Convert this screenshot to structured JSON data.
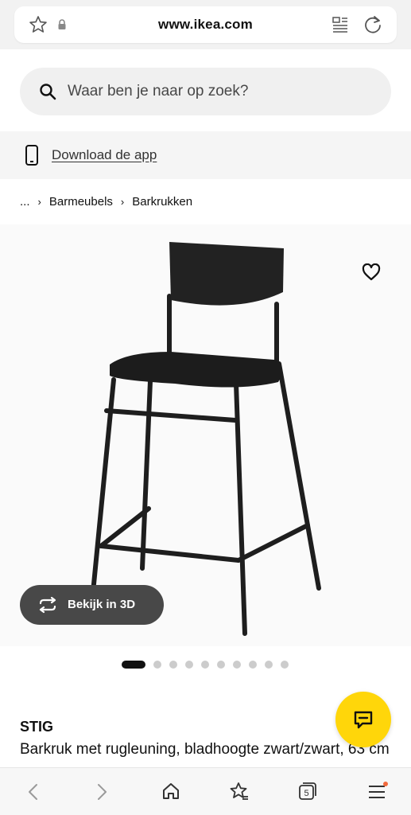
{
  "browser": {
    "url": "www.ikea.com",
    "tab_count": "5"
  },
  "search": {
    "placeholder": "Waar ben je naar op zoek?"
  },
  "app_banner": {
    "label": "Download de app"
  },
  "breadcrumb": {
    "items": [
      "...",
      "Barmeubels",
      "Barkrukken"
    ]
  },
  "product": {
    "name": "STIG",
    "description": "Barkruk met rugleuning, bladhoogte zwart/zwart, 63 cm",
    "view_3d_label": "Bekijk in 3D",
    "image_index": 1,
    "image_count": 10
  },
  "colors": {
    "brand_yellow": "#ffd60a",
    "button_dark": "#484848",
    "notification_dot": "#f26a3d"
  },
  "icons": [
    "star-icon",
    "lock-icon",
    "reader-icon",
    "reload-icon",
    "search-icon",
    "phone-icon",
    "heart-icon",
    "rotate-3d-icon",
    "chat-icon",
    "back-icon",
    "forward-icon",
    "home-icon",
    "bookmarks-icon",
    "tabs-icon",
    "menu-icon"
  ]
}
